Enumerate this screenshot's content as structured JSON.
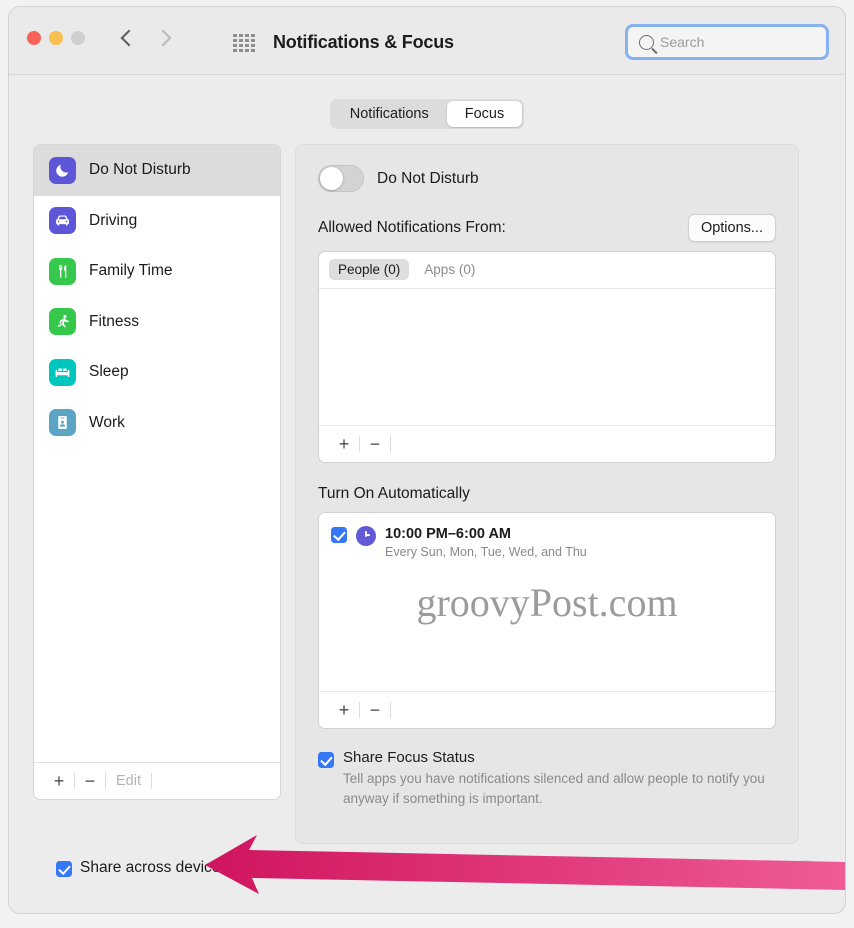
{
  "window": {
    "title": "Notifications & Focus",
    "traffic_lights": [
      "close",
      "minimize",
      "zoom"
    ],
    "nav": {
      "back": "back-chevron",
      "forward": "forward-chevron"
    },
    "grid_icon": "show-all-grid-icon",
    "search": {
      "placeholder": "Search",
      "value": "",
      "icon": "search-icon",
      "focused": true
    }
  },
  "tabs": [
    {
      "label": "Notifications",
      "active": false
    },
    {
      "label": "Focus",
      "active": true
    }
  ],
  "sidebar": {
    "items": [
      {
        "label": "Do Not Disturb",
        "icon": "moon-icon",
        "color": "#5d57d8",
        "selected": true
      },
      {
        "label": "Driving",
        "icon": "car-icon",
        "color": "#5d57d8",
        "selected": false
      },
      {
        "label": "Family Time",
        "icon": "fork-knife-icon",
        "color": "#35c84a",
        "selected": false
      },
      {
        "label": "Fitness",
        "icon": "running-person-icon",
        "color": "#35c84a",
        "selected": false
      },
      {
        "label": "Sleep",
        "icon": "bed-icon",
        "color": "#00c7be",
        "selected": false
      },
      {
        "label": "Work",
        "icon": "id-badge-icon",
        "color": "#5ba4c4",
        "selected": false
      }
    ],
    "toolbar": {
      "add": "+",
      "remove": "−",
      "edit": "Edit",
      "edit_disabled": true
    }
  },
  "panel": {
    "focus_toggle": {
      "label": "Do Not Disturb",
      "on": false
    },
    "allowed": {
      "title": "Allowed Notifications From:",
      "options_button": "Options...",
      "tabs": [
        {
          "label": "People (0)",
          "active": true
        },
        {
          "label": "Apps (0)",
          "active": false
        }
      ],
      "toolbar": {
        "add": "+",
        "remove": "−"
      }
    },
    "auto": {
      "title": "Turn On Automatically",
      "schedules": [
        {
          "checked": true,
          "icon": "clock-icon",
          "time": "10:00 PM–6:00 AM",
          "days": "Every Sun, Mon, Tue, Wed, and Thu"
        }
      ],
      "toolbar": {
        "add": "+",
        "remove": "−"
      }
    },
    "share_focus_status": {
      "checked": true,
      "label": "Share Focus Status",
      "description": "Tell apps you have notifications silenced and allow people to notify you anyway if something is important."
    }
  },
  "watermark": "groovyPost.com",
  "footer": {
    "share_across_devices": {
      "label": "Share across devices",
      "checked": true
    },
    "help_button": "?"
  },
  "annotation": {
    "type": "arrow",
    "color": "#d8276b",
    "points_at": "share-across-devices-checkbox"
  }
}
